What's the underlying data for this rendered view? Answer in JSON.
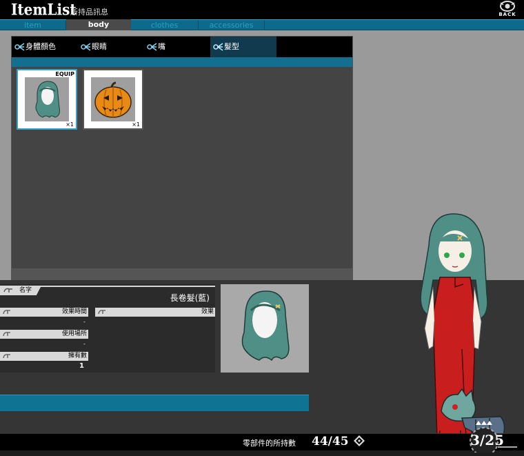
{
  "header": {
    "logo_text": "ItemList",
    "subtitle": "所持品訊息",
    "back_label": "BACK"
  },
  "tabs": [
    {
      "label": "item",
      "active": false
    },
    {
      "label": "body",
      "active": true
    },
    {
      "label": "clothes",
      "active": false
    },
    {
      "label": "accessories",
      "active": false
    }
  ],
  "subtabs": [
    {
      "label": "身體顏色",
      "active": false
    },
    {
      "label": "眼睛",
      "active": false
    },
    {
      "label": "嘴",
      "active": false
    },
    {
      "label": "髮型",
      "active": true
    }
  ],
  "items": [
    {
      "name": "hair-blue-icon",
      "qty": "×1",
      "equipped": true,
      "equip_label": "EQUIP"
    },
    {
      "name": "pumpkin-icon",
      "qty": "×1",
      "equipped": false
    }
  ],
  "details": {
    "name_header": "名字",
    "item_name": "長卷髮(藍)",
    "duration_label": "效果時間",
    "duration_value": "-",
    "effect_label": "效果",
    "location_label": "使用場所",
    "location_value": "-",
    "owned_label": "擁有數",
    "owned_value": "1"
  },
  "status": {
    "label": "零部件的所持數",
    "count": "44/45"
  },
  "page": {
    "indicator": "3/25"
  },
  "colors": {
    "accent_blue": "#0f7394",
    "selected_border": "#3aa0c8",
    "dress_red": "#c81e1e",
    "hair_teal": "#4f8f86"
  }
}
